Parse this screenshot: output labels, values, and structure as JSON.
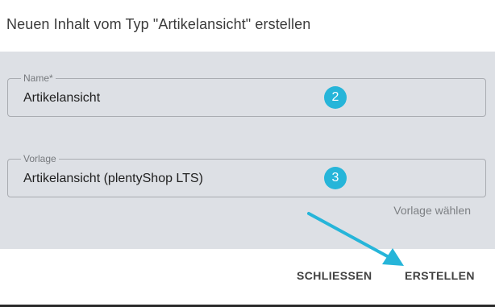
{
  "dialog": {
    "title": "Neuen Inhalt vom Typ \"Artikelansicht\" erstellen"
  },
  "fields": {
    "name": {
      "label": "Name*",
      "value": "Artikelansicht",
      "step_badge": "2"
    },
    "template": {
      "label": "Vorlage",
      "value": "Artikelansicht (plentyShop LTS)",
      "step_badge": "3",
      "choose_link": "Vorlage wählen"
    }
  },
  "actions": {
    "close_label": "SCHLIESSEN",
    "create_label": "ERSTELLEN"
  },
  "colors": {
    "accent": "#26b5d9",
    "panel_background": "#dde0e5"
  },
  "icons": {
    "annotation_arrow": "arrow-icon"
  }
}
